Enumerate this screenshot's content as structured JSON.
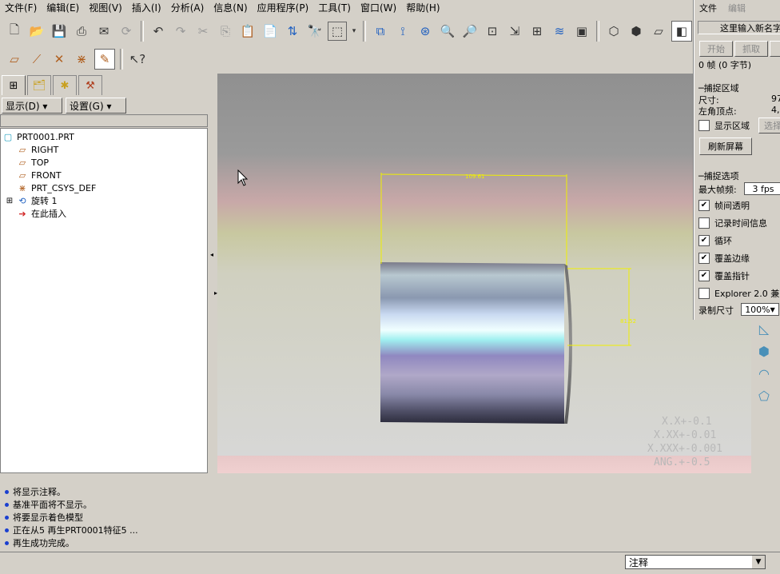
{
  "menu": [
    "文件(F)",
    "编辑(E)",
    "视图(V)",
    "插入(I)",
    "分析(A)",
    "信息(N)",
    "应用程序(P)",
    "工具(T)",
    "窗口(W)",
    "帮助(H)"
  ],
  "nav_buttons": {
    "display": "显示(D) ▾",
    "settings": "设置(G) ▾"
  },
  "tree": {
    "root": "PRT0001.PRT",
    "items": [
      "RIGHT",
      "TOP",
      "FRONT",
      "PRT_CSYS_DEF",
      "旋转 1",
      "在此插入"
    ]
  },
  "model": {
    "dim_width": "109.61",
    "dim_height": "81.52",
    "tolerances": [
      "X.X+-0.1",
      "X.XX+-0.01",
      "X.XXX+-0.001",
      "ANG.+-0.5"
    ]
  },
  "messages": [
    "将显示注释。",
    "基准平面将不显示。",
    "将要显示着色模型",
    "正在从5 再生PRT0001特征5 ...",
    "再生成功完成。"
  ],
  "status_filter": "注释",
  "capture": {
    "menu": [
      "文件",
      "编辑"
    ],
    "title": "这里输入新名字",
    "btn_start": "开始",
    "btn_grab": "抓取",
    "frames": "0 帧 (0 字节)",
    "region_title": "捕捉区域",
    "size_label": "尺寸:",
    "size_value": "97",
    "corner_label": "左角顶点:",
    "corner_value": "4,",
    "show_region": "显示区域",
    "select_btn": "选择",
    "refresh": "刷新屏幕",
    "options_title": "捕捉选项",
    "max_fps_label": "最大帧频:",
    "max_fps": "3 fps",
    "opt1": "帧间透明",
    "opt2": "记录时间信息",
    "opt3": "循环",
    "opt4": "覆盖边缘",
    "opt5": "覆盖指针",
    "opt6": "Explorer 2.0 兼",
    "rec_size_label": "录制尺寸",
    "rec_size": "100%"
  }
}
